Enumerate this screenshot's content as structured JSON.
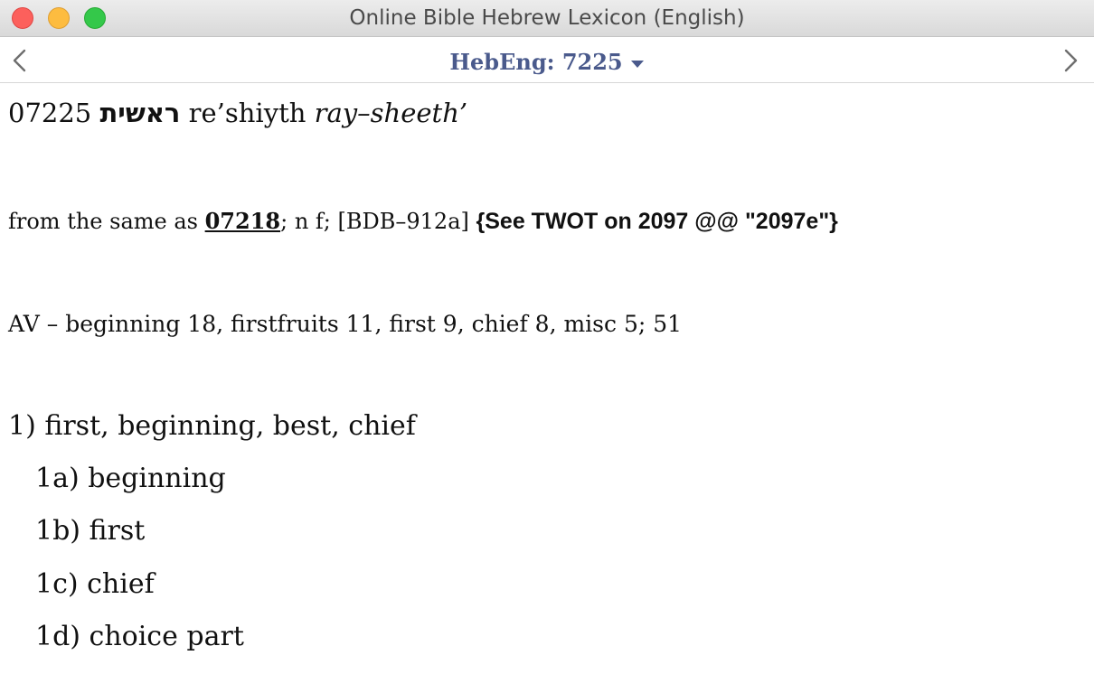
{
  "window": {
    "title": "Online Bible Hebrew Lexicon (English)"
  },
  "nav": {
    "title": "HebEng: 7225",
    "back_icon": "chevron-left-icon",
    "forward_icon": "chevron-right-icon",
    "dropdown_icon": "caret-down-icon"
  },
  "entry": {
    "number": "07225",
    "hebrew": "ראשית",
    "transliteration": "re’shiyth",
    "pronunciation": "ray–sheeth’",
    "etymology": {
      "prefix": "from the same as",
      "ref_link": "07218",
      "rest": "; n f; [BDB–912a]",
      "twot": "{See TWOT on 2097 @@ \"2097e\"}"
    },
    "av": "AV – beginning 18, firstfruits 11, first 9, chief 8, misc 5; 51",
    "definitions": [
      "1) first, beginning, best, chief",
      "1a) beginning",
      "1b) first",
      "1c) chief",
      "1d) choice part"
    ]
  },
  "colors": {
    "nav_title": "#4a5a8c",
    "close": "#fc605c",
    "minimize": "#fdbc40",
    "maximize": "#34c84a"
  }
}
